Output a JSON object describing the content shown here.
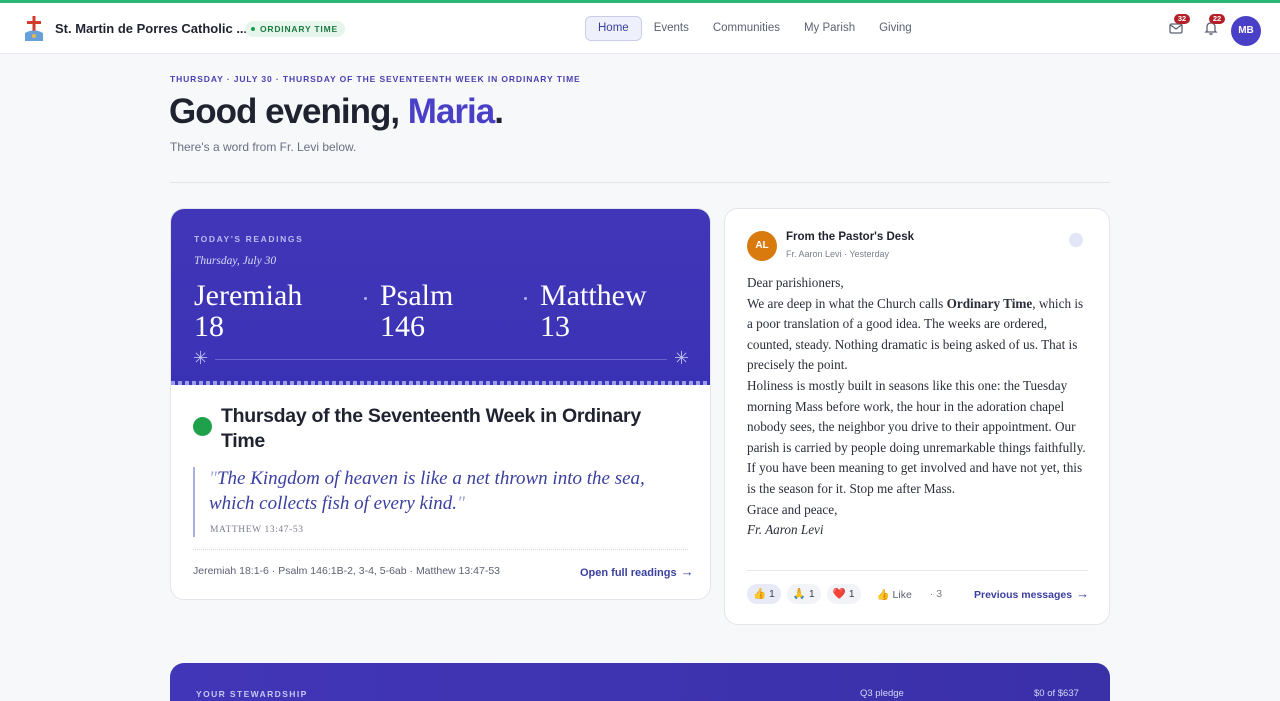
{
  "navbar": {
    "parish_name": "St. Martin de Porres Catholic ...",
    "season_badge": "ORDINARY TIME",
    "links": [
      "Home",
      "Events",
      "Communities",
      "My Parish",
      "Giving"
    ],
    "active_link": "Home",
    "messages_count": "32",
    "notifications_count": "22",
    "user_initials": "MB"
  },
  "header": {
    "dateline": "THURSDAY · JULY 30 · THURSDAY OF THE SEVENTEENTH WEEK IN ORDINARY TIME",
    "greeting_prefix": "Good evening, ",
    "greeting_name": "Maria",
    "greeting_suffix": ".",
    "subtitle": "There's a word from Fr. Levi below."
  },
  "readings": {
    "label": "TODAY'S READINGS",
    "date": "Thursday, July 30",
    "books": [
      {
        "name": "Jeremiah",
        "chapter": "18"
      },
      {
        "name": "Psalm",
        "chapter": "146"
      },
      {
        "name": "Matthew",
        "chapter": "13"
      }
    ],
    "feast_title": "Thursday of the Seventeenth Week in Ordinary Time",
    "feast_color": "#1fa14c",
    "quote": "The Kingdom of heaven is like a net thrown into the sea, which collects fish of every kind.",
    "quote_ref": "MATTHEW 13:47-53",
    "refs": "Jeremiah 18:1-6 · Psalm 146:1B-2, 3-4, 5-6ab · Matthew 13:47-53",
    "open_label": "Open full readings"
  },
  "pastor": {
    "initials": "AL",
    "heading": "From the Pastor's Desk",
    "meta": "Fr. Aaron Levi · Yesterday",
    "salutation": "Dear parishioners,",
    "p1_before": "We are deep in what the Church calls ",
    "p1_bold": "Ordinary Time",
    "p1_after": ", which is a poor translation of a good idea. The weeks are ordered, counted, steady. Nothing dramatic is being asked of us. That is precisely the point.",
    "p2": "Holiness is mostly built in seasons like this one: the Tuesday morning Mass before work, the hour in the adoration chapel nobody sees, the neighbor you drive to their appointment. Our parish is carried by people doing unremarkable things faithfully.",
    "p3": "If you have been meaning to get involved and have not yet, this is the season for it. Stop me after Mass.",
    "closing": "Grace and peace,",
    "signature": "Fr. Aaron Levi",
    "reactions": [
      {
        "emoji": "👍",
        "count": "1"
      },
      {
        "emoji": "🙏",
        "count": "1"
      },
      {
        "emoji": "❤️",
        "count": "1"
      }
    ],
    "like_label": "Like",
    "total": "· 3",
    "previous_label": "Previous messages"
  },
  "stewardship": {
    "label": "YOUR STEWARDSHIP",
    "pledge_label": "Q3 pledge",
    "amount": "$0 of $637"
  }
}
